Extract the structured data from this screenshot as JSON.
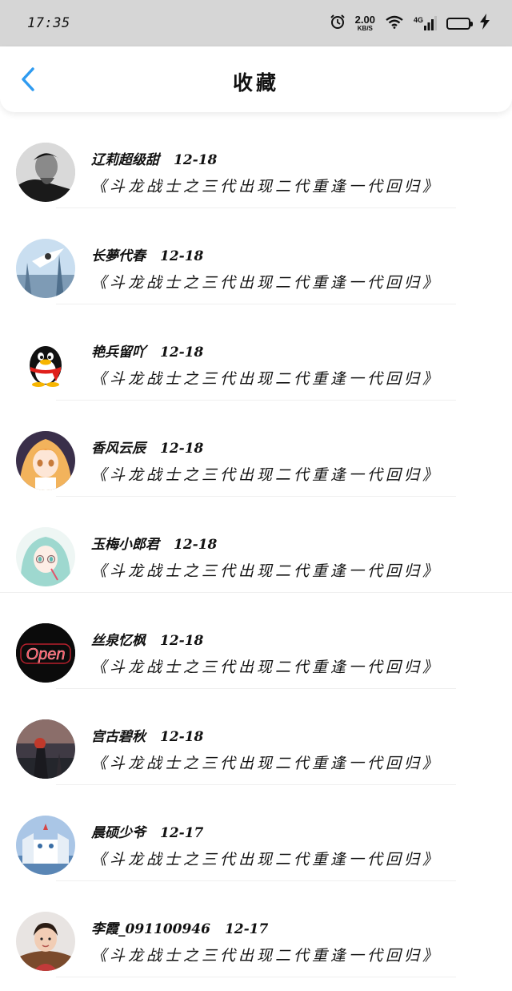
{
  "status_bar": {
    "time": "17:35",
    "speed_value": "2.00",
    "speed_unit": "KB/S",
    "network": "4G",
    "icons": [
      "alarm-icon",
      "wifi-icon",
      "signal-icon",
      "battery-icon",
      "charging-icon"
    ]
  },
  "nav": {
    "title": "收藏",
    "back_icon": "chevron-left-icon",
    "accent_color": "#2f9bf0"
  },
  "favorites": [
    {
      "name": "辽莉超级甜",
      "date": "12-18",
      "message": "《斗龙战士之三代出现二代重逢一代回归》"
    },
    {
      "name": "长夢代春",
      "date": "12-18",
      "message": "《斗龙战士之三代出现二代重逢一代回归》"
    },
    {
      "name": "艳兵留吖",
      "date": "12-18",
      "message": "《斗龙战士之三代出现二代重逢一代回归》"
    },
    {
      "name": "香风云辰",
      "date": "12-18",
      "message": "《斗龙战士之三代出现二代重逢一代回归》"
    },
    {
      "name": "玉梅小郎君",
      "date": "12-18",
      "message": "《斗龙战士之三代出现二代重逢一代回归》"
    },
    {
      "name": "丝泉忆枫",
      "date": "12-18",
      "message": "《斗龙战士之三代出现二代重逢一代回归》"
    },
    {
      "name": "宫古碧秋",
      "date": "12-18",
      "message": "《斗龙战士之三代出现二代重逢一代回归》"
    },
    {
      "name": "晨硕少爷",
      "date": "12-17",
      "message": "《斗龙战士之三代出现二代重逢一代回归》"
    },
    {
      "name": "李霞_091100946",
      "date": "12-17",
      "message": "《斗龙战士之三代出现二代重逢一代回归》"
    }
  ],
  "avatar_texts": {
    "neon_sign": "Open"
  }
}
